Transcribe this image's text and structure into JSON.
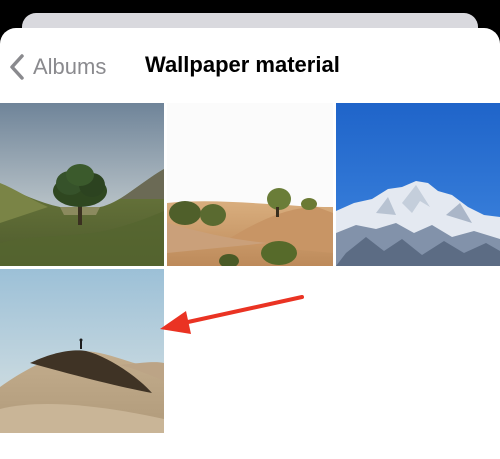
{
  "header": {
    "back_label": "Albums",
    "title": "Wallpaper material"
  },
  "photos": [
    {
      "subject": "lone tree on grassy hillside"
    },
    {
      "subject": "desert dunes with green shrubs"
    },
    {
      "subject": "snowy mountain under blue sky"
    },
    {
      "subject": "person standing on sand dune"
    }
  ],
  "annotation": {
    "arrow_color": "#ea3323",
    "points_to": "photo-4"
  },
  "colors": {
    "back_label": "#8a8a8e",
    "background": "#ffffff"
  }
}
